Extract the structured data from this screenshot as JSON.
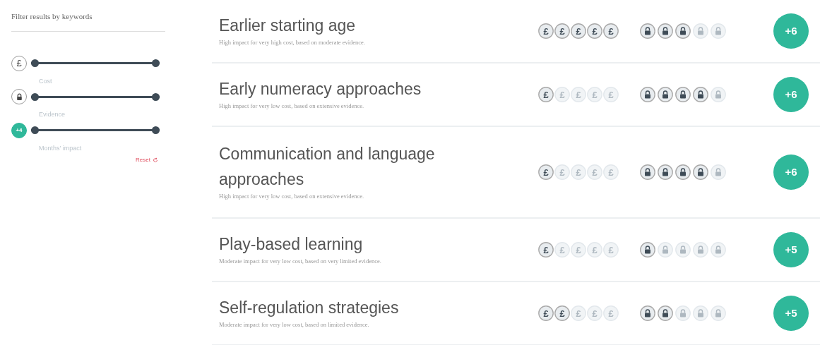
{
  "sidebar": {
    "title": "Filter results by keywords",
    "filters": [
      {
        "kind": "cost",
        "icon_text": "£",
        "label": "Cost",
        "level": 1
      },
      {
        "kind": "evidence",
        "label": "Evidence",
        "level": 1
      },
      {
        "kind": "impact",
        "icon_text": "+4",
        "label": "Months' impact",
        "level": 1
      }
    ],
    "reset": "Reset"
  },
  "results": [
    {
      "title": "Earlier starting age",
      "summary": "High impact for very high cost, based on moderate evidence.",
      "cost": [
        {
          "symbol": "£",
          "filled": true
        },
        {
          "symbol": "£",
          "filled": true
        },
        {
          "symbol": "£",
          "filled": true
        },
        {
          "symbol": "£",
          "filled": true
        },
        {
          "symbol": "£",
          "filled": true
        }
      ],
      "evidence": {
        "stars": 3
      },
      "impact": "+6"
    },
    {
      "title": "Early numeracy approaches",
      "summary": "High impact for very low cost, based on extensive evidence.",
      "cost": [
        {
          "symbol": "£",
          "filled": true
        },
        {
          "symbol": "£",
          "filled": false
        },
        {
          "symbol": "£",
          "filled": false
        },
        {
          "symbol": "£",
          "filled": false
        },
        {
          "symbol": "£",
          "filled": false
        }
      ],
      "evidence": {
        "stars": 4
      },
      "impact": "+6"
    },
    {
      "title": "Communication and language approaches",
      "summary": "High impact for very low cost, based on extensive evidence.",
      "cost": [
        {
          "symbol": "£",
          "filled": true
        },
        {
          "symbol": "£",
          "filled": false
        },
        {
          "symbol": "£",
          "filled": false
        },
        {
          "symbol": "£",
          "filled": false
        },
        {
          "symbol": "£",
          "filled": false
        }
      ],
      "evidence": {
        "stars": 4
      },
      "impact": "+6"
    },
    {
      "title": "Play-based learning",
      "summary": "Moderate impact for very low cost, based on very limited evidence.",
      "cost": [
        {
          "symbol": "£",
          "filled": true
        },
        {
          "symbol": "£",
          "filled": false
        },
        {
          "symbol": "£",
          "filled": false
        },
        {
          "symbol": "£",
          "filled": false
        },
        {
          "symbol": "£",
          "filled": false
        }
      ],
      "evidence": {
        "stars": 1
      },
      "impact": "+5"
    },
    {
      "title": "Self-regulation strategies",
      "summary": "Moderate impact for very low cost, based on limited evidence.",
      "cost": [
        {
          "symbol": "£",
          "filled": true
        },
        {
          "symbol": "£",
          "filled": true
        },
        {
          "symbol": "£",
          "filled": false
        },
        {
          "symbol": "£",
          "filled": false
        },
        {
          "symbol": "£",
          "filled": false
        }
      ],
      "evidence": {
        "stars": 2
      },
      "impact": "+5"
    }
  ]
}
